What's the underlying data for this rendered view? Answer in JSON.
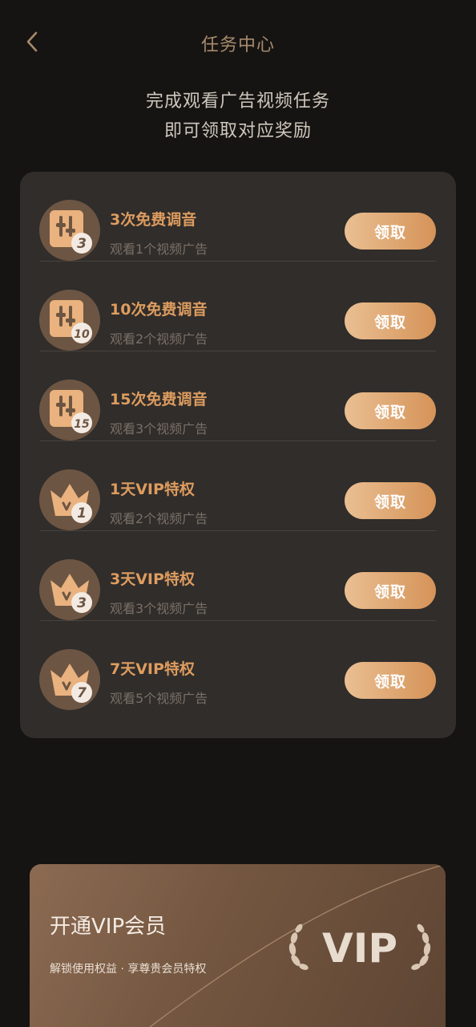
{
  "header": {
    "title": "任务中心"
  },
  "subtitle": {
    "line1": "完成观看广告视频任务",
    "line2": "即可领取对应奖励"
  },
  "colors": {
    "accent": "#dd9c5f",
    "background": "#161412",
    "card": "#302d2b"
  },
  "tasks": [
    {
      "icon": "tuning-icon",
      "badge": "3",
      "title": "3次免费调音",
      "desc": "观看1个视频广告",
      "button": "领取"
    },
    {
      "icon": "tuning-icon",
      "badge": "10",
      "title": "10次免费调音",
      "desc": "观看2个视频广告",
      "button": "领取"
    },
    {
      "icon": "tuning-icon",
      "badge": "15",
      "title": "15次免费调音",
      "desc": "观看3个视频广告",
      "button": "领取"
    },
    {
      "icon": "crown-icon",
      "badge": "1",
      "title": "1天VIP特权",
      "desc": "观看2个视频广告",
      "button": "领取"
    },
    {
      "icon": "crown-icon",
      "badge": "3",
      "title": "3天VIP特权",
      "desc": "观看3个视频广告",
      "button": "领取"
    },
    {
      "icon": "crown-icon",
      "badge": "7",
      "title": "7天VIP特权",
      "desc": "观看5个视频广告",
      "button": "领取"
    }
  ],
  "vip": {
    "title": "开通VIP会员",
    "subtitle": "解锁使用权益 · 享尊贵会员特权",
    "badge_text": "VIP"
  }
}
